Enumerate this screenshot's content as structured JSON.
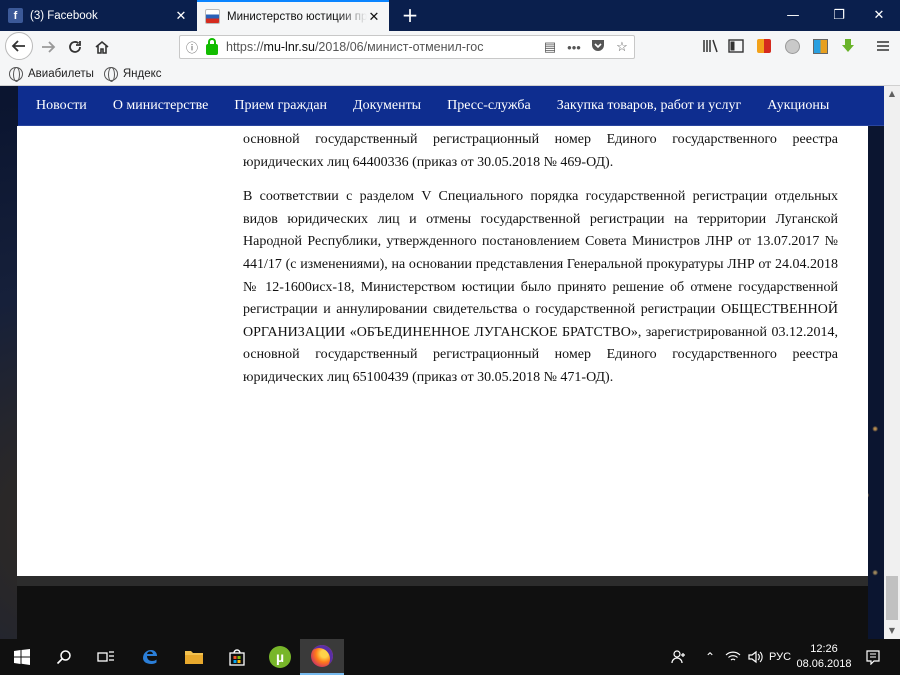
{
  "browser": {
    "tabs": [
      {
        "title": "(3) Facebook",
        "active": false
      },
      {
        "title": "Министерство юстиции при",
        "active": true
      }
    ],
    "url_prefix": "https://",
    "url_host": "mu-lnr.su",
    "url_path": "/2018/06/минист-отменил-гос",
    "bookmarks": [
      {
        "label": "Авиабилеты"
      },
      {
        "label": "Яндекс"
      }
    ]
  },
  "site": {
    "nav": [
      "Новости",
      "О министерстве",
      "Прием граждан",
      "Документы",
      "Пресс-служба",
      "Закупка товаров, работ и услуг",
      "Аукционы"
    ]
  },
  "article": {
    "paragraphs": [
      "основной государственный регистрационный номер Единого государственного реестра юридических лиц 64400336 (приказ от 30.05.2018 № 469-ОД).",
      "В соответствии с разделом V Специального порядка государственной регистрации отдельных видов юридических лиц и отмены государственной регистрации на территории Луганской Народной Республики, утвержденного постановлением Совета Министров ЛНР от 13.07.2017 № 441/17 (с изменениями), на основании представления Генеральной прокуратуры ЛНР от 24.04.2018 № 12-1600исх-18, Министерством юстиции было принято решение об отмене государственной регистрации и аннулировании свидетельства о государственной регистрации ОБЩЕСТВЕННОЙ ОРГАНИЗАЦИИ «ОБЪЕДИНЕННОЕ ЛУГАНСКОЕ БРАТСТВО», зарегистрированной 03.12.2014, основной государственный регистрационный номер Единого государственного реестра юридических лиц 65100439 (приказ от 30.05.2018 № 471-ОД)."
    ]
  },
  "taskbar": {
    "language": "РУС",
    "time": "12:26",
    "date": "08.06.2018"
  },
  "colors": {
    "site_nav": "#0e2d8f",
    "tab_strip": "#0a1f4d",
    "lock_green": "#12bc00"
  }
}
